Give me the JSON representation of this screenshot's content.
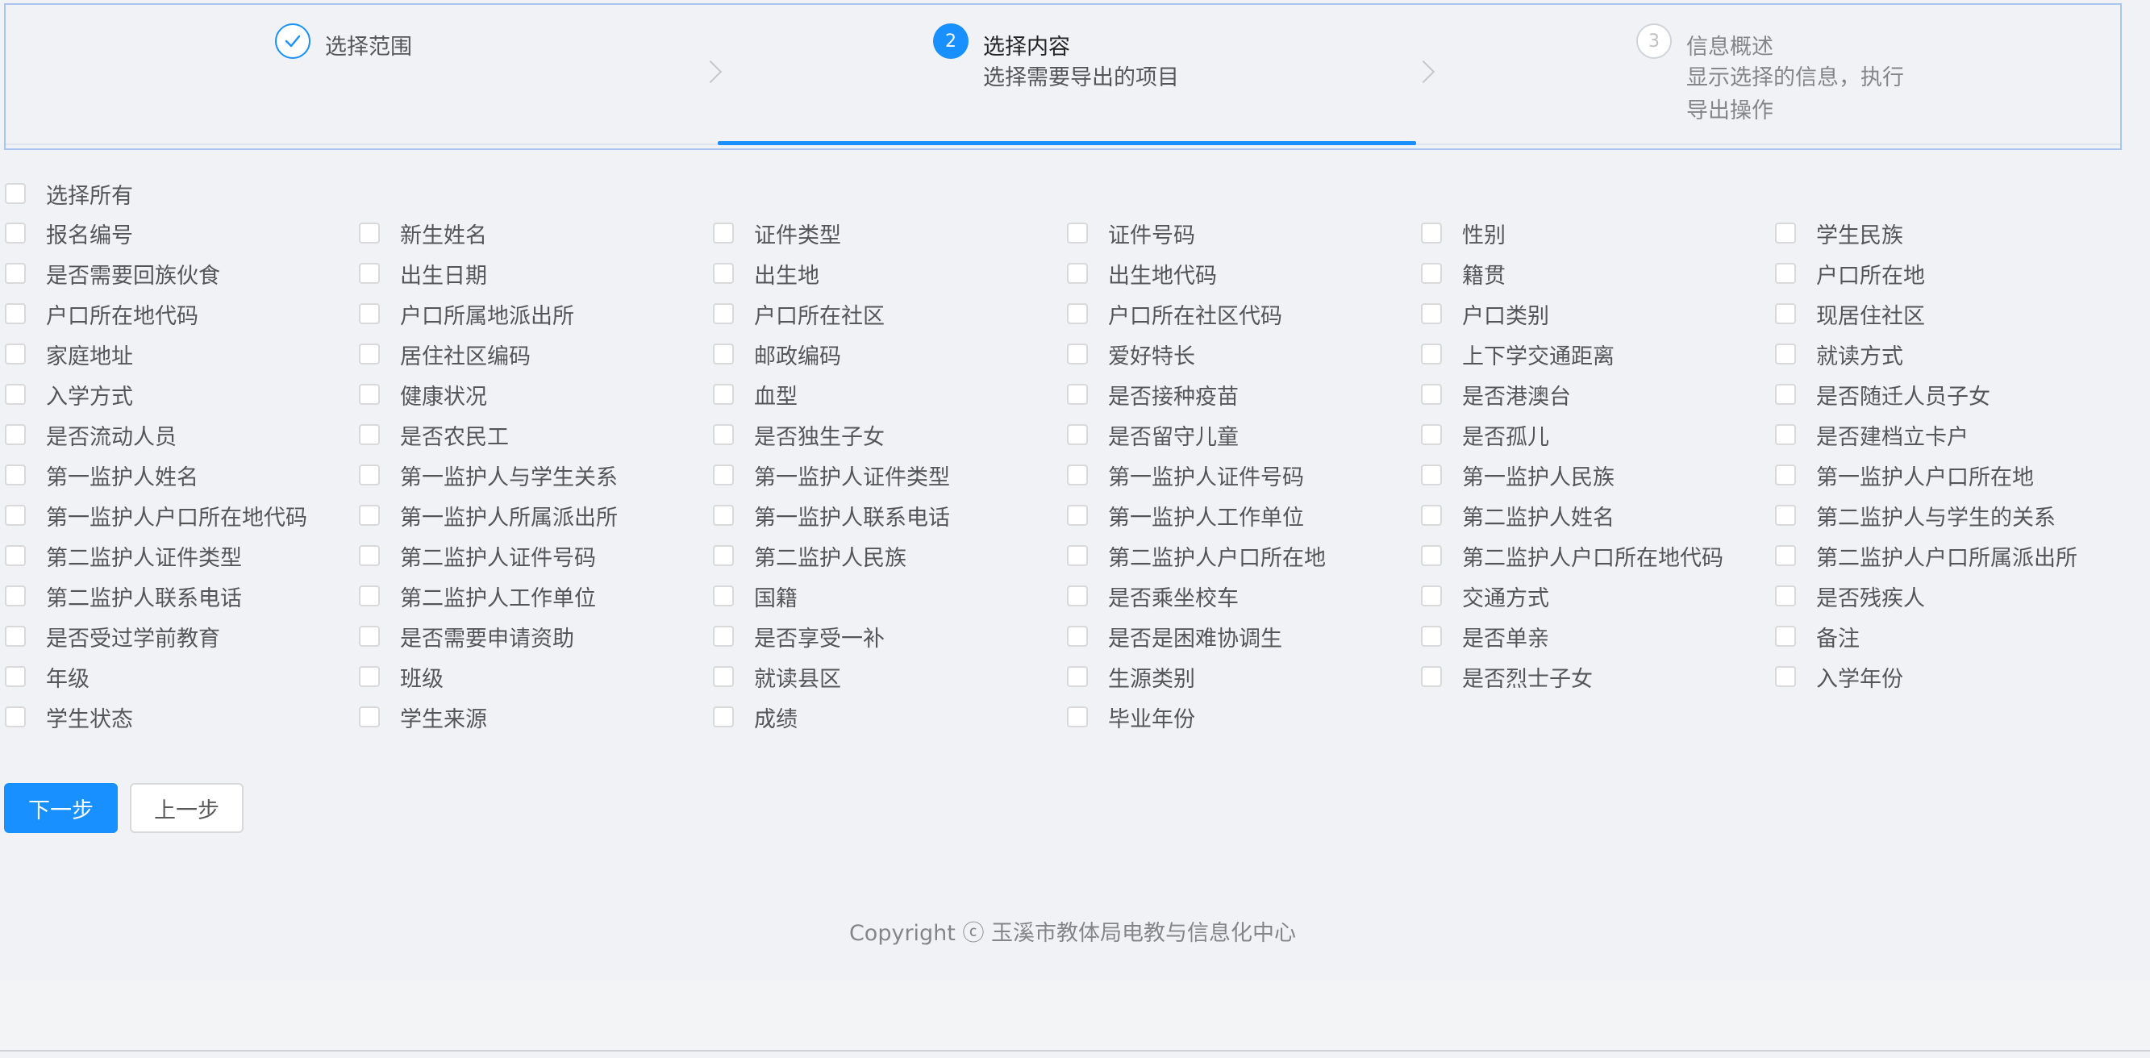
{
  "steps": [
    {
      "icon": "check-icon",
      "title": "选择范围",
      "status": "finish"
    },
    {
      "number": "2",
      "title": "选择内容",
      "description": "选择需要导出的项目",
      "status": "process"
    },
    {
      "number": "3",
      "title": "信息概述",
      "description_lines": [
        "显示选择的信息，执行",
        "导出操作"
      ],
      "status": "wait"
    }
  ],
  "select_all_label": "选择所有",
  "fields": [
    "报名编号",
    "新生姓名",
    "证件类型",
    "证件号码",
    "性别",
    "学生民族",
    "是否需要回族伙食",
    "出生日期",
    "出生地",
    "出生地代码",
    "籍贯",
    "户口所在地",
    "户口所在地代码",
    "户口所属地派出所",
    "户口所在社区",
    "户口所在社区代码",
    "户口类别",
    "现居住社区",
    "家庭地址",
    "居住社区编码",
    "邮政编码",
    "爱好特长",
    "上下学交通距离",
    "就读方式",
    "入学方式",
    "健康状况",
    "血型",
    "是否接种疫苗",
    "是否港澳台",
    "是否随迁人员子女",
    "是否流动人员",
    "是否农民工",
    "是否独生子女",
    "是否留守儿童",
    "是否孤儿",
    "是否建档立卡户",
    "第一监护人姓名",
    "第一监护人与学生关系",
    "第一监护人证件类型",
    "第一监护人证件号码",
    "第一监护人民族",
    "第一监护人户口所在地",
    "第一监护人户口所在地代码",
    "第一监护人所属派出所",
    "第一监护人联系电话",
    "第一监护人工作单位",
    "第二监护人姓名",
    "第二监护人与学生的关系",
    "第二监护人证件类型",
    "第二监护人证件号码",
    "第二监护人民族",
    "第二监护人户口所在地",
    "第二监护人户口所在地代码",
    "第二监护人户口所属派出所",
    "第二监护人联系电话",
    "第二监护人工作单位",
    "国籍",
    "是否乘坐校车",
    "交通方式",
    "是否残疾人",
    "是否受过学前教育",
    "是否需要申请资助",
    "是否享受一补",
    "是否是困难协调生",
    "是否单亲",
    "备注",
    "年级",
    "班级",
    "就读县区",
    "生源类别",
    "是否烈士子女",
    "入学年份",
    "学生状态",
    "学生来源",
    "成绩",
    "毕业年份"
  ],
  "buttons": {
    "next": "下一步",
    "prev": "上一步"
  },
  "footer": "Copyright ⓒ 玉溪市教体局电教与信息化中心",
  "colors": {
    "primary": "#1890ff",
    "background": "#f0f2f5"
  }
}
